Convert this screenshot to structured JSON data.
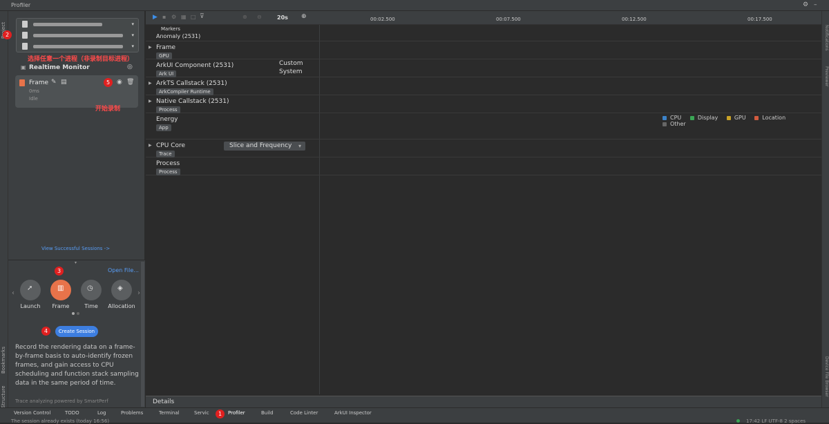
{
  "window": {
    "title": "Profiler"
  },
  "left_strip": {
    "project": "Project",
    "bookmarks": "Bookmarks",
    "structure": "Structure"
  },
  "right_strip": {
    "notifications": "Notifications",
    "previewer": "Previewer",
    "device_file_browser": "Device File Browser"
  },
  "session_panel": {
    "hint": "选择任意一个进程（非录制目标进程）",
    "realtime_monitor": "Realtime Monitor",
    "frame_card": {
      "title": "Frame",
      "time": "0ms",
      "state": "Idle"
    },
    "start_record_hint": "开始录制",
    "view_sessions": "View Successful Sessions ->",
    "open_file": "Open File...",
    "session_types": [
      {
        "label": "Launch"
      },
      {
        "label": "Frame"
      },
      {
        "label": "Time"
      },
      {
        "label": "Allocation"
      }
    ],
    "create_session": "Create Session",
    "description": "Record the rendering data on a frame-by-frame basis to auto-identify frozen frames, and gain access to CPU scheduling and function stack sampling data in the same period of time.",
    "powered_by": "Trace analyzing powered by SmartPerf"
  },
  "badges": {
    "b1": "1",
    "b2": "2",
    "b3": "3",
    "b4": "4",
    "b5": "5"
  },
  "toolbar": {
    "duration": "20s"
  },
  "ruler": {
    "ticks": [
      "00:02.500",
      "00:07.500",
      "00:12.500",
      "00:17.500"
    ]
  },
  "markers": {
    "label": "Markers"
  },
  "tracks": [
    {
      "name": "Anomaly (2531)",
      "tag": ""
    },
    {
      "name": "Frame",
      "tag": "GPU"
    },
    {
      "name": "ArkUI Component (2531)",
      "tag": "Ark UI"
    },
    {
      "name": "ArkTS Callstack (2531)",
      "tag": "ArkCompiler Runtime"
    },
    {
      "name": "Native Callstack (2531)",
      "tag": "Process"
    },
    {
      "name": "Energy",
      "tag": "App"
    },
    {
      "name": "CPU Core",
      "tag": "Trace"
    },
    {
      "name": "Process",
      "tag": "Process"
    }
  ],
  "custom_system": {
    "line1": "Custom",
    "line2": "System"
  },
  "slice_dropdown": "Slice and Frequency",
  "legend": [
    {
      "label": "CPU",
      "color": "#3c82c8"
    },
    {
      "label": "Display",
      "color": "#3aa655"
    },
    {
      "label": "GPU",
      "color": "#c9a227"
    },
    {
      "label": "Location",
      "color": "#d25b3f"
    },
    {
      "label": "Other",
      "color": "#666666"
    }
  ],
  "details": {
    "label": "Details"
  },
  "bottom_tabs": [
    "Version Control",
    "TODO",
    "Log",
    "Problems",
    "Terminal",
    "Servic",
    "Profiler",
    "Build",
    "Code Linter",
    "ArkUI Inspector"
  ],
  "status": {
    "message": "The session already exists (today 16:56)",
    "right": "17:42  LF  UTF-8  2 spaces"
  }
}
